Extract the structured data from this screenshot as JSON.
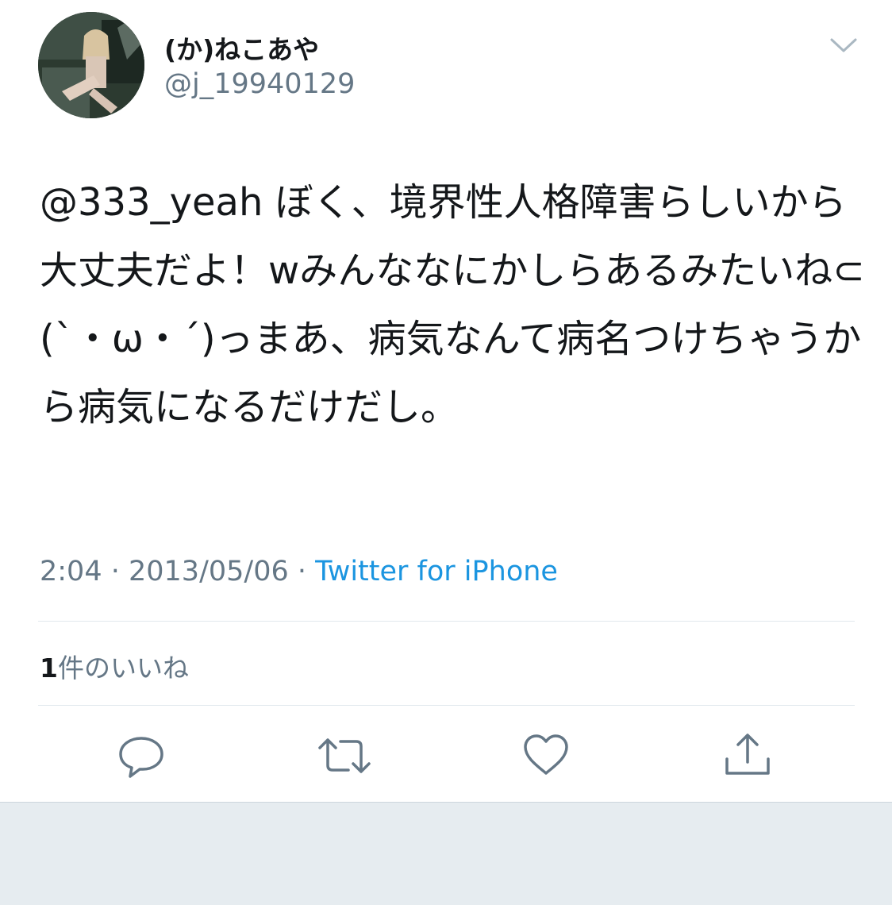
{
  "user": {
    "display_name": "(か)ねこあや",
    "handle": "@j_19940129"
  },
  "tweet": {
    "mention": "@333_yeah",
    "body": " ぼく、境界性人格障害らしいから大丈夫だよ！wみんななにかしらあるみたいね⊂(`・ω・´)っまあ、病気なんて病名つけちゃうから病気になるだけだし。",
    "time": "2:04",
    "date": "2013/05/06",
    "separator": " · ",
    "source": "Twitter for iPhone"
  },
  "likes": {
    "count": "1",
    "label": "件のいいね"
  },
  "icons": {
    "caret": "chevron-down-icon",
    "reply": "reply-icon",
    "retweet": "retweet-icon",
    "like": "heart-icon",
    "share": "share-icon"
  },
  "colors": {
    "text": "#14171a",
    "secondary": "#657786",
    "link": "#1b95e0",
    "divider": "#e1e8ed",
    "footer_bg": "#e6ecf0"
  }
}
